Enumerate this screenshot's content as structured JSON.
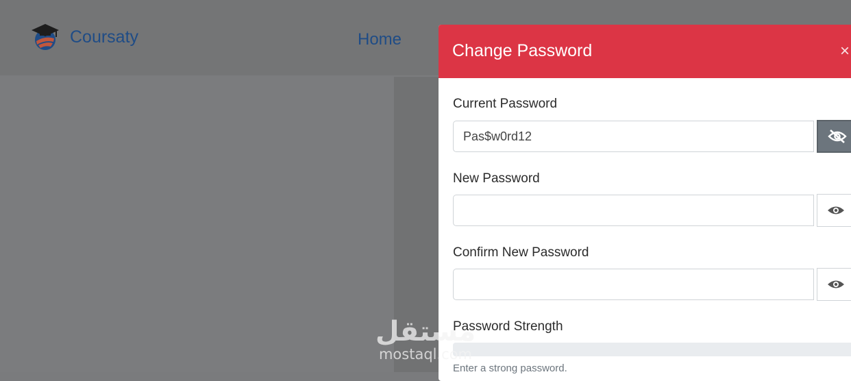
{
  "navbar": {
    "brand_name": "Coursaty",
    "home_link": "Home"
  },
  "modal": {
    "title": "Change Password",
    "close_glyph": "×",
    "header_color": "#dc3545",
    "fields": [
      {
        "label": "Current Password",
        "value": "Pas$w0rd12",
        "toggle_icon": "eye-slash-icon",
        "toggle_active": true
      },
      {
        "label": "New Password",
        "value": "",
        "toggle_icon": "eye-icon",
        "toggle_active": false
      },
      {
        "label": "Confirm New Password",
        "value": "",
        "toggle_icon": "eye-icon",
        "toggle_active": false
      }
    ],
    "strength": {
      "label": "Password Strength",
      "level": 0,
      "help_text": "Enter a strong password."
    }
  },
  "watermark": {
    "arabic": "مستقل",
    "latin": "mostaql.com"
  }
}
